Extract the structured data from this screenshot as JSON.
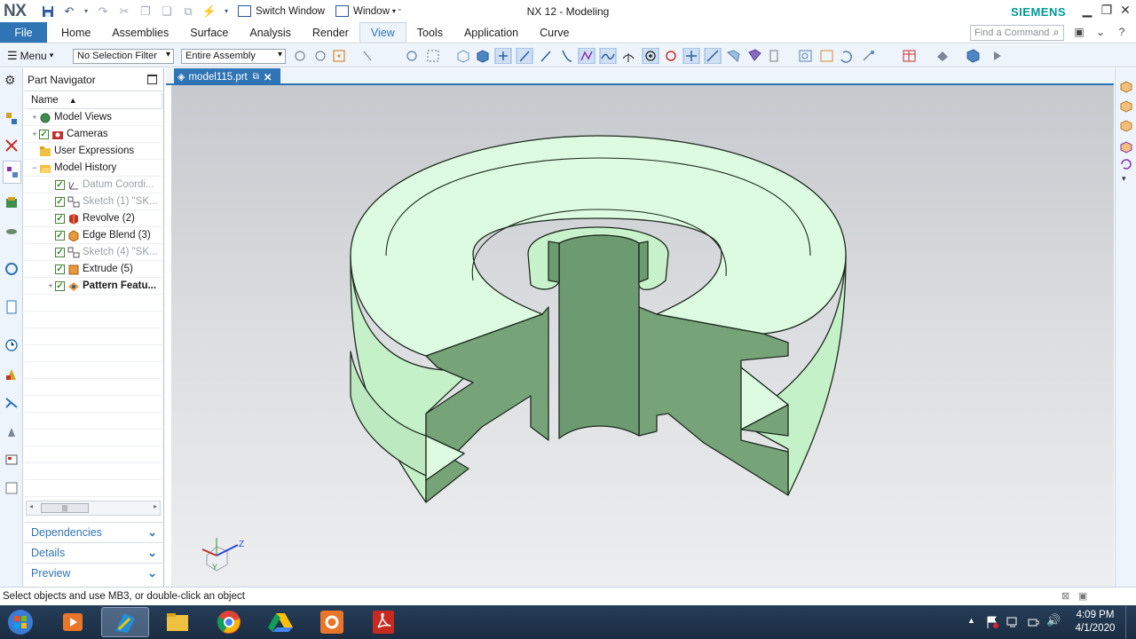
{
  "app": {
    "logo": "NX",
    "title": "NX 12 - Modeling",
    "brand": "SIEMENS",
    "switch_window": "Switch Window",
    "window_menu": "Window"
  },
  "ribbon": {
    "file": "File",
    "tabs": [
      "Home",
      "Assemblies",
      "Surface",
      "Analysis",
      "Render",
      "View",
      "Tools",
      "Application",
      "Curve"
    ],
    "active_tab": "View",
    "find_placeholder": "Find a Command"
  },
  "toolbar": {
    "menu": "Menu",
    "selection_filter": "No Selection Filter",
    "scope": "Entire Assembly"
  },
  "navigator": {
    "title": "Part Navigator",
    "column_header": "Name",
    "rows": [
      {
        "label": "Model Views",
        "indent": 0,
        "expander": "+",
        "check": false,
        "icon": "model-views-icon",
        "style": "normal"
      },
      {
        "label": "Cameras",
        "indent": 0,
        "expander": "+",
        "check": true,
        "icon": "camera-icon",
        "style": "normal"
      },
      {
        "label": "User Expressions",
        "indent": 0,
        "expander": "",
        "check": false,
        "icon": "folder-icon",
        "style": "normal"
      },
      {
        "label": "Model History",
        "indent": 0,
        "expander": "−",
        "check": false,
        "icon": "folder-open-icon",
        "style": "normal"
      },
      {
        "label": "Datum Coordi...",
        "indent": 1,
        "expander": "",
        "check": true,
        "icon": "datum-csys-icon",
        "style": "dim"
      },
      {
        "label": "Sketch (1) \"SK...",
        "indent": 1,
        "expander": "",
        "check": true,
        "icon": "sketch-icon",
        "style": "dim"
      },
      {
        "label": "Revolve (2)",
        "indent": 1,
        "expander": "",
        "check": true,
        "icon": "revolve-icon",
        "style": "normal"
      },
      {
        "label": "Edge Blend (3)",
        "indent": 1,
        "expander": "",
        "check": true,
        "icon": "edge-blend-icon",
        "style": "normal"
      },
      {
        "label": "Sketch (4) \"SK...",
        "indent": 1,
        "expander": "",
        "check": true,
        "icon": "sketch-icon",
        "style": "dim"
      },
      {
        "label": "Extrude (5)",
        "indent": 1,
        "expander": "",
        "check": true,
        "icon": "extrude-icon",
        "style": "normal"
      },
      {
        "label": "Pattern Featu...",
        "indent": 1,
        "expander": "+",
        "check": true,
        "icon": "pattern-icon",
        "style": "bold"
      }
    ],
    "panels": [
      "Dependencies",
      "Details",
      "Preview"
    ]
  },
  "document": {
    "tab": "model115.prt"
  },
  "triad": {
    "z_label": "Z",
    "y_label": "Y"
  },
  "status": "Select objects and use MB3, or double-click an object",
  "taskbar": {
    "time": "4:09 PM",
    "date": "4/1/2020"
  },
  "colors": {
    "accent": "#2f74b5",
    "brand": "#009999",
    "part_top": "#dcfbe0",
    "part_cut": "#76a378"
  }
}
